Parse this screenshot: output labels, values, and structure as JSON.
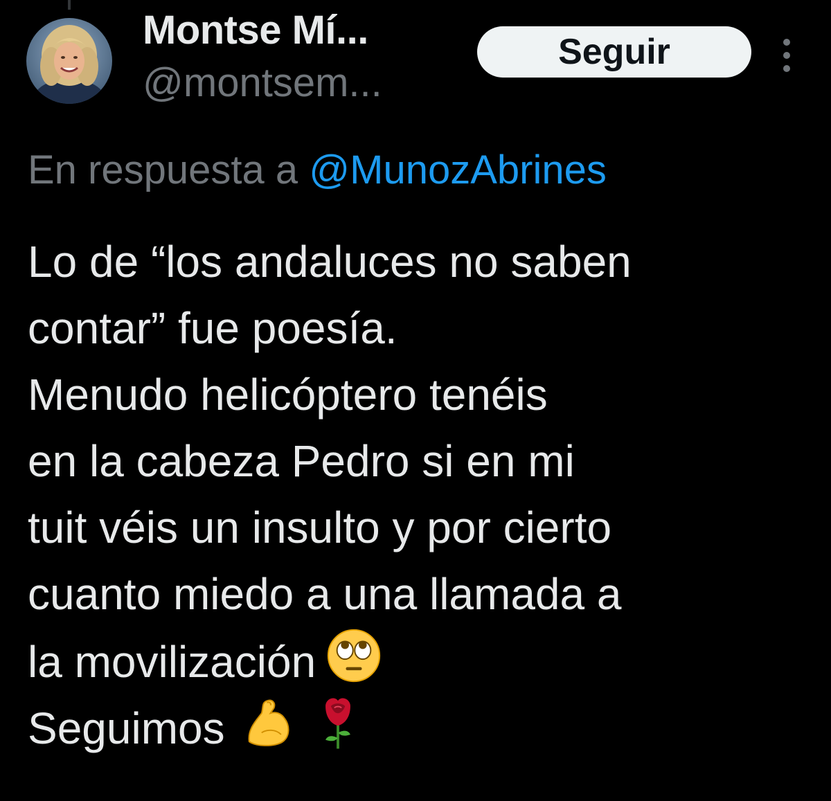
{
  "author": {
    "display_name": "Montse Mí...",
    "handle": "@montsem...",
    "avatar": "woman-blonde-smiling-avatar"
  },
  "follow_button": {
    "label": "Seguir"
  },
  "more_button": {
    "icon": "more-vertical-icon"
  },
  "reply_context": {
    "prefix": "En respuesta a",
    "mention": "@MunozAbrines"
  },
  "tweet": {
    "lines": [
      "Lo de “los andaluces no saben",
      "contar” fue poesía.",
      "Menudo helicóptero tenéis",
      "en la cabeza Pedro si en mi",
      "tuit véis un insulto y por cierto",
      "cuanto miedo a una llamada a",
      "la movilización",
      "Seguimos"
    ],
    "emojis": {
      "eye_roll": "face-with-rolling-eyes-emoji",
      "flexed_biceps": "flexed-biceps-emoji",
      "rose": "rose-emoji"
    }
  },
  "colors": {
    "background": "#000000",
    "primary_text": "#e7e9ea",
    "secondary_text": "#71767b",
    "link": "#1d9bf0",
    "follow_button_bg": "#eff3f4",
    "follow_button_text": "#0f1419"
  }
}
